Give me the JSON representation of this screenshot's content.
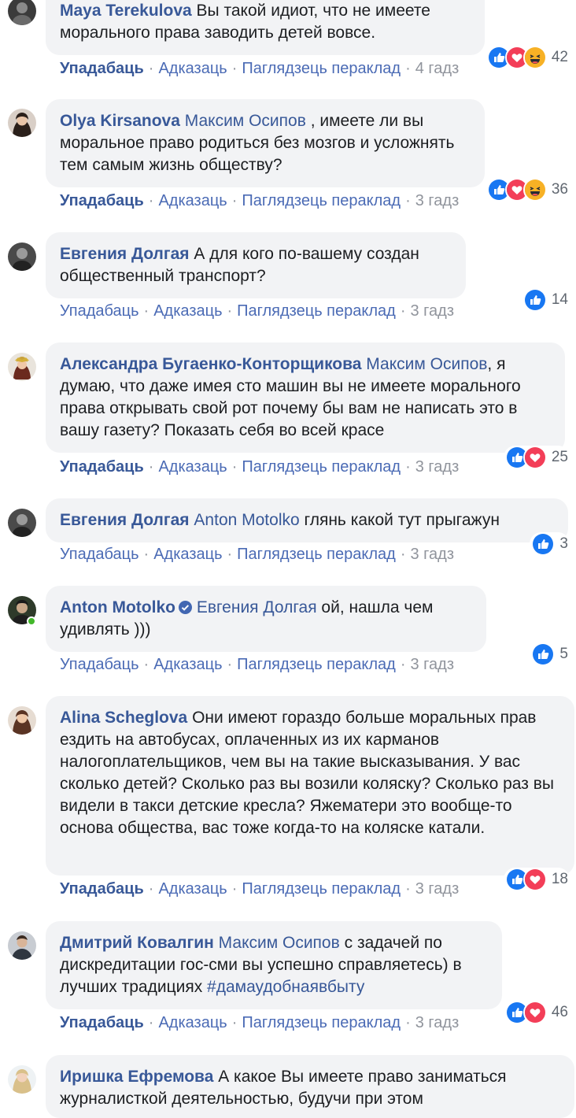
{
  "colors": {
    "link": "#385898",
    "bubble": "#f2f3f5",
    "meta": "#90949c",
    "like": "#1877f2",
    "love": "#f33e58",
    "haha": "#f7b125"
  },
  "actions": {
    "like": "Упадабаць",
    "reply": "Адказаць",
    "translation": "Паглядзець пераклад",
    "separator": "·"
  },
  "comments": [
    {
      "author": "Maya Terekulova",
      "mention": "",
      "text": "Вы такой идиот, что не имеете морального права заводить детей вовсе.",
      "time": "4 гадз",
      "liked": true,
      "reactions": [
        "like",
        "love",
        "haha"
      ],
      "count": "42"
    },
    {
      "author": "Olya Kirsanova",
      "mention": "Максим Осипов",
      "text": ", имеете ли вы моральное право родиться без мозгов и усложнять тем самым жизнь обществу?",
      "time": "3 гадз",
      "liked": true,
      "reactions": [
        "like",
        "love",
        "haha"
      ],
      "count": "36"
    },
    {
      "author": "Евгения Долгая",
      "mention": "",
      "text": "А для кого по-вашему создан общественный транспорт?",
      "time": "3 гадз",
      "liked": false,
      "reactions": [
        "like"
      ],
      "count": "14"
    },
    {
      "author": "Александра Бугаенко-Конторщикова",
      "mention": "Максим Осипов",
      "text": ", я думаю, что даже имея сто машин вы не имеете морального права открывать свой рот почему бы вам не написать это в вашу газету? Показать себя во всей красе",
      "time": "3 гадз",
      "liked": true,
      "reactions": [
        "like",
        "love"
      ],
      "count": "25"
    },
    {
      "author": "Евгения Долгая",
      "mention": "Anton Motolko",
      "text": "глянь какой тут прыгажун",
      "time": "3 гадз",
      "liked": false,
      "reactions": [
        "like"
      ],
      "count": "3"
    },
    {
      "author": "Anton Motolko",
      "mention": "Евгения Долгая",
      "text": "ой, нашла чем удивлять )))",
      "time": "3 гадз",
      "liked": false,
      "reactions": [
        "like"
      ],
      "count": "5",
      "verified": true,
      "online": true
    },
    {
      "author": "Alina Scheglova",
      "mention": "",
      "text": "Они имеют гораздо больше моральных прав ездить на автобусах, оплаченных из их карманов налогоплательщиков, чем вы на такие высказывания. У вас сколько детей? Сколько раз вы возили коляску? Сколько раз вы видели в такси детские кресла? Яжематери это вообще-то основа общества, вас тоже когда-то на коляске катали.",
      "time": "3 гадз",
      "liked": true,
      "reactions": [
        "like",
        "love"
      ],
      "count": "18"
    },
    {
      "author": "Дмитрий Ковалгин",
      "mention": "Максим Осипов",
      "text": "с задачей по дискредитации гос-сми вы успешно справляетесь) в лучших традициях",
      "hashtag": "#дамаудобнаявбыту",
      "time": "3 гадз",
      "liked": true,
      "reactions": [
        "like",
        "love"
      ],
      "count": "46"
    },
    {
      "author": "Иришка Ефремова",
      "mention": "",
      "text": "А какое Вы имеете право заниматься журналисткой деятельностью, будучи при этом",
      "time": "",
      "liked": false,
      "reactions": [],
      "count": ""
    }
  ]
}
